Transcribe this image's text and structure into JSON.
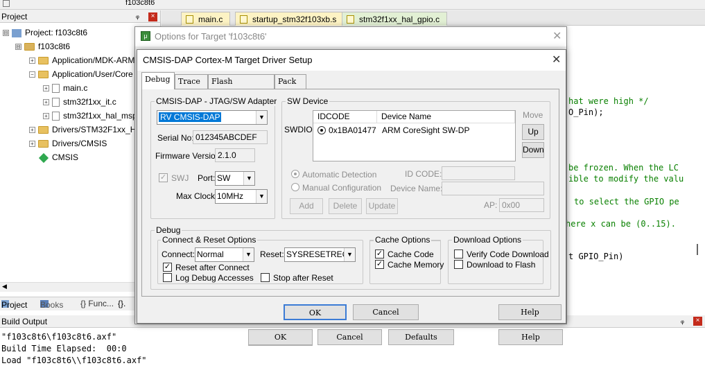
{
  "ide": {
    "toolbar_target": "f103c8t6",
    "project_pane_title": "Project",
    "tree": [
      {
        "label": "Project: f103c8t6",
        "kind": "root",
        "toggle": "⊟"
      },
      {
        "label": "f103c8t6",
        "kind": "target",
        "toggle": "⊟"
      },
      {
        "label": "Application/MDK-ARM",
        "kind": "folder",
        "toggle": "+"
      },
      {
        "label": "Application/User/Core",
        "kind": "folder",
        "toggle": "−"
      },
      {
        "label": "main.c",
        "kind": "file",
        "toggle": "+"
      },
      {
        "label": "stm32f1xx_it.c",
        "kind": "file",
        "toggle": "+"
      },
      {
        "label": "stm32f1xx_hal_msp.c",
        "kind": "file",
        "toggle": "+"
      },
      {
        "label": "Drivers/STM32F1xx_HAL_Driver",
        "kind": "folder",
        "toggle": "+"
      },
      {
        "label": "Drivers/CMSIS",
        "kind": "folder",
        "toggle": "+"
      },
      {
        "label": "CMSIS",
        "kind": "component",
        "toggle": ""
      }
    ],
    "pane_tabs": [
      "Project",
      "Books",
      "{} Func...",
      "{}."
    ],
    "editor_tabs": [
      "main.c",
      "startup_stm32f103xb.s",
      "stm32f1xx_hal_gpio.c"
    ],
    "code_lines": [
      {
        "text": "hat were high */",
        "comment": true
      },
      {
        "text": "O_Pin);",
        "comment": false
      },
      {
        "text": "be frozen. When the LC",
        "comment": true
      },
      {
        "text": "ible to modify the valu",
        "comment": true
      },
      {
        "text": "to select the GPIO pe",
        "comment": true
      },
      {
        "text": "here x can be (0..15).",
        "comment": true
      },
      {
        "text": "t GPIO_Pin)",
        "comment": false
      }
    ],
    "build_title": "Build Output",
    "build_lines": [
      "\"f103c8t6\\f103c8t6.axf\" ",
      "Build Time Elapsed:  00:0",
      "Load \"f103c8t6\\\\f103c8t6.axf\""
    ]
  },
  "outer_dialog": {
    "title": "Options for Target 'f103c8t6'",
    "ok": "OK",
    "cancel": "Cancel",
    "defaults": "Defaults",
    "help": "Help"
  },
  "dialog": {
    "title": "CMSIS-DAP Cortex-M Target Driver Setup",
    "tabs": [
      "Debug",
      "Trace",
      "Flash Download",
      "Pack"
    ],
    "adapter": {
      "group": "CMSIS-DAP - JTAG/SW Adapter",
      "selected": "RV CMSIS-DAP",
      "serial_label": "Serial No:",
      "serial": "012345ABCDEF",
      "firmware_label": "Firmware Version:",
      "firmware": "2.1.0",
      "swj_label": "SWJ",
      "port_label": "Port:",
      "port": "SW",
      "clock_label": "Max Clock:",
      "clock": "10MHz"
    },
    "swdevice": {
      "group": "SW Device",
      "swdio_label": "SWDIO",
      "col_idcode": "IDCODE",
      "col_name": "Device Name",
      "row_idcode": "0x1BA01477",
      "row_name": "ARM CoreSight SW-DP",
      "move_label": "Move",
      "up": "Up",
      "down": "Down",
      "auto_detect": "Automatic Detection",
      "manual_config": "Manual Configuration",
      "id_code_label": "ID CODE:",
      "device_name_label": "Device Name:",
      "add": "Add",
      "delete": "Delete",
      "update": "Update",
      "ap_label": "AP:",
      "ap_value": "0x00"
    },
    "debug": {
      "group": "Debug",
      "connect_group": "Connect & Reset Options",
      "connect_label": "Connect:",
      "connect": "Normal",
      "reset_label": "Reset:",
      "reset": "SYSRESETREQ",
      "reset_after_connect": "Reset after Connect",
      "log_debug": "Log Debug Accesses",
      "stop_after_reset": "Stop after Reset",
      "cache_group": "Cache Options",
      "cache_code": "Cache Code",
      "cache_memory": "Cache Memory",
      "download_group": "Download Options",
      "verify_code": "Verify Code Download",
      "download_flash": "Download to Flash"
    },
    "ok": "OK",
    "cancel": "Cancel",
    "help": "Help"
  }
}
